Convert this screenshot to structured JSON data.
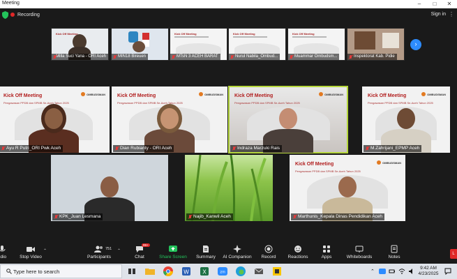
{
  "window": {
    "title": "Meeting",
    "controls": [
      "–",
      "□",
      "✕"
    ]
  },
  "top": {
    "recording_label": "Recording",
    "sign_in": "Sign in"
  },
  "gallery": [
    {
      "name": "Milla Suci Yana - ORI Aceh",
      "kind": "person"
    },
    {
      "name": "MIN18 Bireuen",
      "kind": "flag"
    },
    {
      "name": "MTsN 3 ACEH BARAT",
      "kind": "slide"
    },
    {
      "name": "Nurul Nabila_Ombud...",
      "kind": "slide"
    },
    {
      "name": "Muammar Ombudsm...",
      "kind": "slide"
    },
    {
      "name": "Inspektorat Kab. Pidie",
      "kind": "room"
    }
  ],
  "slide_text": {
    "title": "Kick Off Meeting",
    "subtitle": "Pengawasan PPDB dan SPMB Se-Aceh Tahun 2025",
    "logo": "OMBUDSMAN"
  },
  "tiles_row1": [
    {
      "name": "Ayu R Putri_ORI Pwk Aceh"
    },
    {
      "name": "Dian Rubianty - ORI Aceh"
    },
    {
      "name": "Indraza Marzuki Rais",
      "active_speaker": true
    },
    {
      "name": "M.Zahrijani_EPMP Aceh"
    }
  ],
  "tiles_row2": [
    {
      "name": "KPK_Juan Lesmana"
    },
    {
      "name": "Najib_Kanwil Aceh"
    },
    {
      "name": "Marthunis_Kepala Dinas Pendidikan Aceh"
    }
  ],
  "toolbar": {
    "audio": "udio",
    "video": "Stop Video",
    "participants": "Participants",
    "participants_count": "751",
    "chat": "Chat",
    "chat_badge": "99+",
    "share": "Share Screen",
    "summary": "Summary",
    "companion": "AI Companion",
    "record": "Record",
    "reactions": "Reactions",
    "apps": "Apps",
    "whiteboards": "Whiteboards",
    "notes": "Notes",
    "leave": "L"
  },
  "taskbar": {
    "search_placeholder": "Type here to search",
    "time": "9:42 AM",
    "date": "4/23/2025"
  },
  "colors": {
    "accent": "#2d8cff",
    "share_green": "#23c25b",
    "speaker_outline": "#b5d63c",
    "record_red": "#e02828"
  }
}
